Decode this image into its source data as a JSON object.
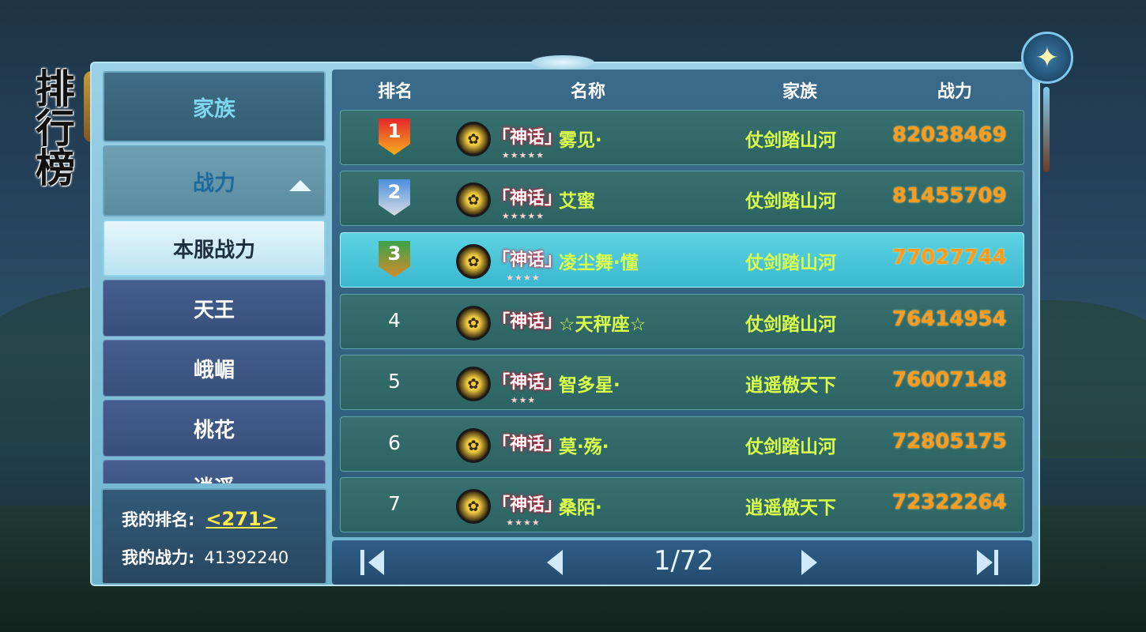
{
  "page_title": "排行榜",
  "sidebar": {
    "categories": [
      {
        "label": "家族"
      },
      {
        "label": "战力"
      }
    ],
    "sub_items": [
      {
        "label": "本服战力"
      },
      {
        "label": "天王"
      },
      {
        "label": "峨嵋"
      },
      {
        "label": "桃花"
      },
      {
        "label": "逍遥"
      }
    ]
  },
  "my_info": {
    "rank_label": "我的排名:",
    "rank_value": "<271>",
    "power_label": "我的战力:",
    "power_value": "41392240"
  },
  "table": {
    "headers": {
      "rank": "排名",
      "name": "名称",
      "family": "家族",
      "power": "战力"
    },
    "rows": [
      {
        "rank": "1",
        "title": "「神话」",
        "stars": "★★★★★",
        "name": "雾见·",
        "family": "仗剑踏山河",
        "power": "82038469"
      },
      {
        "rank": "2",
        "title": "「神话」",
        "stars": "★★★★★",
        "name": "艾蜜",
        "family": "仗剑踏山河",
        "power": "81455709"
      },
      {
        "rank": "3",
        "title": "「神话」",
        "stars": "★★★★",
        "name": "凌尘舞·懂",
        "family": "仗剑踏山河",
        "power": "77027744"
      },
      {
        "rank": "4",
        "title": "「神话」",
        "stars": "",
        "name": "☆天秤座☆",
        "family": "仗剑踏山河",
        "power": "76414954"
      },
      {
        "rank": "5",
        "title": "「神话」",
        "stars": "★★★",
        "name": "智多星·",
        "family": "逍遥傲天下",
        "power": "76007148"
      },
      {
        "rank": "6",
        "title": "「神话」",
        "stars": "",
        "name": "莫·殇·",
        "family": "仗剑踏山河",
        "power": "72805175"
      },
      {
        "rank": "7",
        "title": "「神话」",
        "stars": "★★★★",
        "name": "桑陌·",
        "family": "逍遥傲天下",
        "power": "72322264"
      }
    ]
  },
  "pager": {
    "page": "1/72"
  },
  "colors": {
    "highlight": "#3ab8cf",
    "name_color": "#d9ff4a",
    "power_color": "#ff9a1a"
  }
}
